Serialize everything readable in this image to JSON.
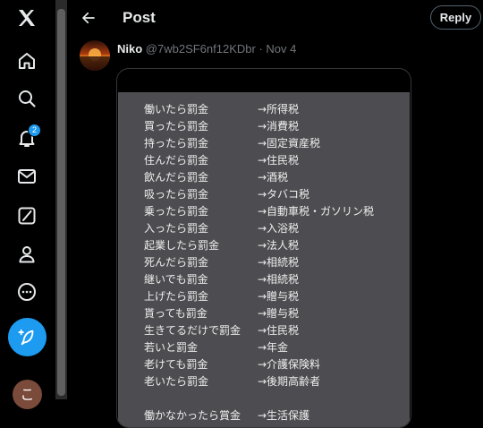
{
  "nav": {
    "notifications_badge": "2",
    "profile_initial": "こ"
  },
  "header": {
    "title": "Post",
    "reply_label": "Reply"
  },
  "tweet": {
    "author_name": "Niko",
    "handle_date": "@7wb2SF6nf12KDbr · Nov 4"
  },
  "image_rows": [
    {
      "left": "働いたら罰金",
      "right": "→所得税"
    },
    {
      "left": "買ったら罰金",
      "right": "→消費税"
    },
    {
      "left": "持ったら罰金",
      "right": "→固定資産税"
    },
    {
      "left": "住んだら罰金",
      "right": "→住民税"
    },
    {
      "left": "飲んだら罰金",
      "right": "→酒税"
    },
    {
      "left": "吸ったら罰金",
      "right": "→タバコ税"
    },
    {
      "left": "乗ったら罰金",
      "right": "→自動車税・ガソリン税"
    },
    {
      "left": "入ったら罰金",
      "right": "→入浴税"
    },
    {
      "left": "起業したら罰金",
      "right": "→法人税"
    },
    {
      "left": "死んだら罰金",
      "right": "→相続税"
    },
    {
      "left": "継いでも罰金",
      "right": "→相続税"
    },
    {
      "left": "上げたら罰金",
      "right": "→贈与税"
    },
    {
      "left": "貰っても罰金",
      "right": "→贈与税"
    },
    {
      "left": "生きてるだけで罰金",
      "right": "→住民税"
    },
    {
      "left": "若いと罰金",
      "right": "→年金"
    },
    {
      "left": "老けても罰金",
      "right": "→介護保険料"
    },
    {
      "left": "老いたら罰金",
      "right": "→後期高齢者"
    },
    {
      "left": "働かなかったら賞金",
      "right": "→生活保護"
    }
  ]
}
